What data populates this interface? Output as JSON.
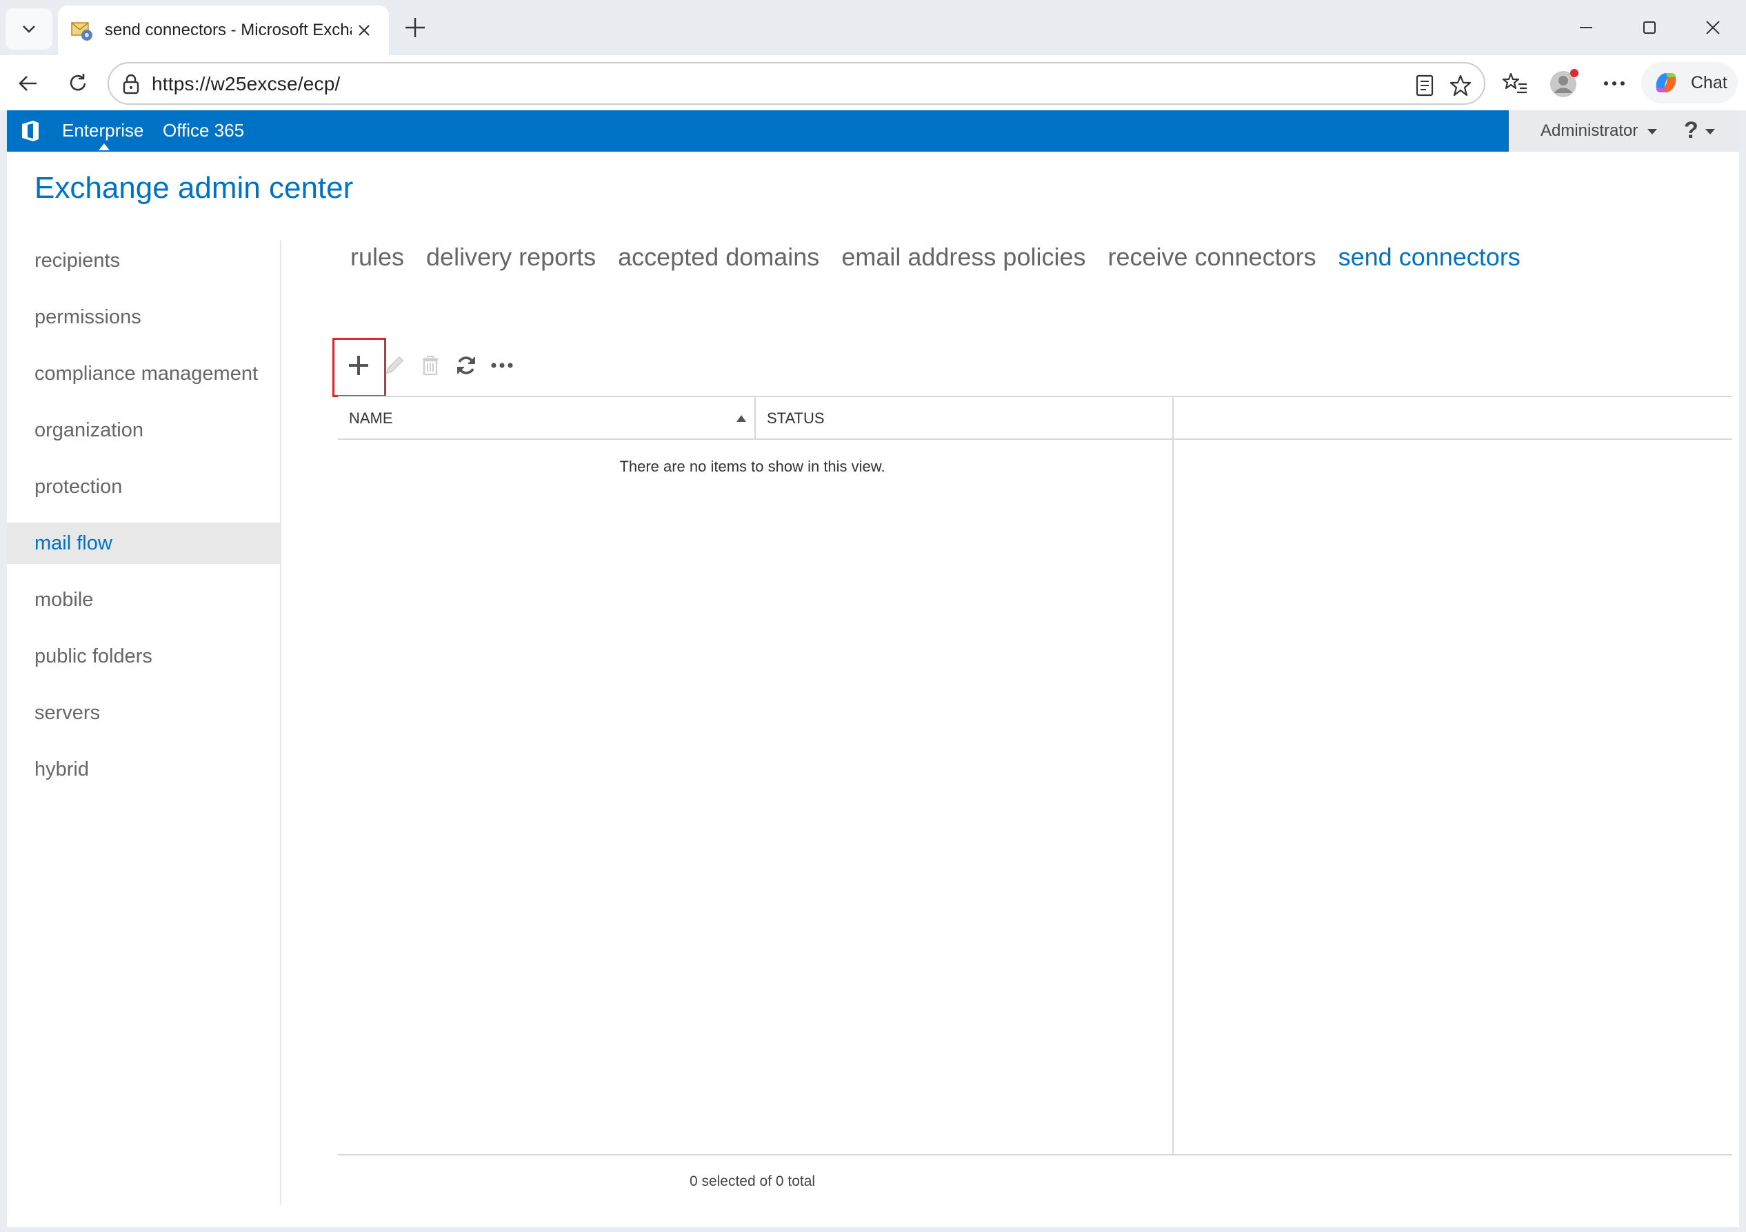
{
  "browser": {
    "tab_title": "send connectors - Microsoft Excha",
    "url": "https://w25excse/ecp/",
    "chat_label": "Chat"
  },
  "o365": {
    "links": [
      "Enterprise",
      "Office 365"
    ],
    "user": "Administrator",
    "help": "?",
    "accent": "#0072c6"
  },
  "app": {
    "title": "Exchange admin center"
  },
  "leftnav": {
    "items": [
      "recipients",
      "permissions",
      "compliance management",
      "organization",
      "protection",
      "mail flow",
      "mobile",
      "public folders",
      "servers",
      "hybrid"
    ],
    "active": "mail flow"
  },
  "subnav": {
    "items": [
      "rules",
      "delivery reports",
      "accepted domains",
      "email address policies",
      "receive connectors",
      "send connectors"
    ],
    "active": "send connectors"
  },
  "toolbar": {
    "icons": [
      "plus-icon",
      "pencil-icon",
      "trash-icon",
      "refresh-icon",
      "more-icon"
    ],
    "highlight_color": "#e0282e"
  },
  "grid": {
    "columns": [
      "NAME",
      "STATUS"
    ],
    "empty_message": "There are no items to show in this view.",
    "status_text": "0 selected of 0 total"
  }
}
